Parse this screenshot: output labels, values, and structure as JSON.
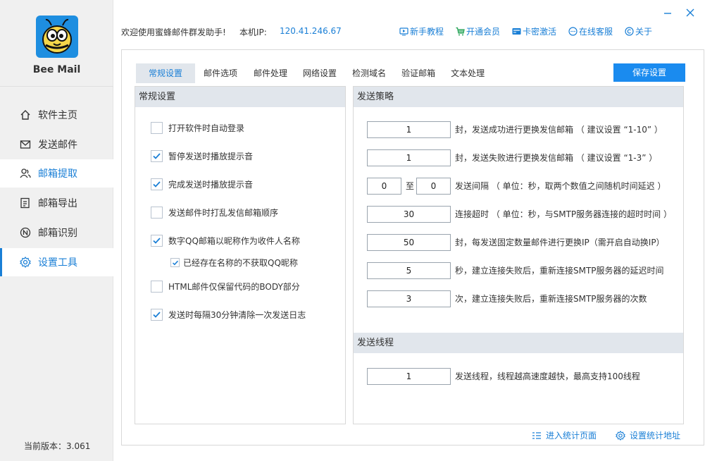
{
  "app": {
    "name": "Bee Mail",
    "version_label": "当前版本：3.061"
  },
  "sidebar": {
    "items": [
      {
        "label": "软件主页",
        "icon": "home-icon"
      },
      {
        "label": "发送邮件",
        "icon": "mail-icon"
      },
      {
        "label": "邮箱提取",
        "icon": "users-icon"
      },
      {
        "label": "邮箱导出",
        "icon": "export-icon"
      },
      {
        "label": "邮箱识别",
        "icon": "recognize-icon"
      },
      {
        "label": "设置工具",
        "icon": "gear-icon"
      }
    ]
  },
  "topbar": {
    "welcome": "欢迎使用蜜蜂邮件群发助手!",
    "ip_label": "本机IP:",
    "ip_value": "120.41.246.67",
    "links": [
      {
        "label": "新手教程",
        "icon": "video-icon"
      },
      {
        "label": "开通会员",
        "icon": "cart-icon"
      },
      {
        "label": "卡密激活",
        "icon": "card-icon"
      },
      {
        "label": "在线客服",
        "icon": "chat-icon"
      },
      {
        "label": "关于",
        "icon": "copyright-icon"
      }
    ]
  },
  "tabs": [
    "常规设置",
    "邮件选项",
    "邮件处理",
    "网络设置",
    "检测域名",
    "验证邮箱",
    "文本处理"
  ],
  "save_button": "保存设置",
  "general": {
    "title": "常规设置",
    "options": [
      {
        "label": "打开软件时自动登录",
        "checked": false
      },
      {
        "label": "暂停发送时播放提示音",
        "checked": true
      },
      {
        "label": "完成发送时播放提示音",
        "checked": true
      },
      {
        "label": "发送邮件时打乱发信邮箱顺序",
        "checked": false
      },
      {
        "label": "数字QQ邮箱以昵称作为收件人名称",
        "checked": true
      },
      {
        "label": "已经存在名称的不获取QQ昵称",
        "checked": true
      },
      {
        "label": "HTML邮件仅保留代码的BODY部分",
        "checked": false
      },
      {
        "label": "发送时每隔30分钟清除一次发送日志",
        "checked": true
      }
    ]
  },
  "strategy": {
    "title": "发送策略",
    "rows": [
      {
        "value": "1",
        "text": "封，发送成功进行更换发信邮箱 （ 建议设置 “1-10” ）"
      },
      {
        "value": "1",
        "text": "封，发送失败进行更换发信邮箱 （ 建议设置 “1-3” ）"
      },
      {
        "value_min": "0",
        "sep": "至",
        "value_max": "0",
        "text": "发送间隔 （ 单位：秒，取两个数值之间随机时间延迟 ）"
      },
      {
        "value": "30",
        "text": "连接超时 （ 单位：秒，与SMTP服务器连接的超时时间 ）"
      },
      {
        "value": "50",
        "text": "封，每发送固定数量邮件进行更换IP（需开启自动换IP）"
      },
      {
        "value": "5",
        "text": "秒，建立连接失败后，重新连接SMTP服务器的延迟时间"
      },
      {
        "value": "3",
        "text": "次，建立连接失败后，重新连接SMTP服务器的次数"
      }
    ]
  },
  "threads": {
    "title": "发送线程",
    "value": "1",
    "text": "发送线程，线程越高速度越快，最高支持100线程"
  },
  "footer": {
    "stats_page": "进入统计页面",
    "stats_config": "设置统计地址"
  },
  "colors": {
    "accent": "#1a7fd6",
    "button": "#1a8bef",
    "panel_header": "#e1e6ec"
  }
}
